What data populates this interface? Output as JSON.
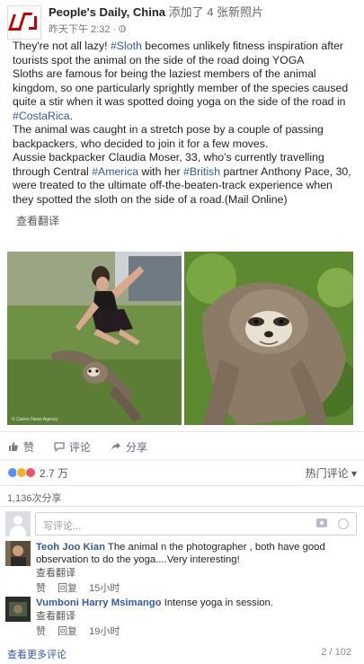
{
  "header": {
    "page_name": "People's Daily, China",
    "action_text": "添加了 4 张新照片",
    "time": "昨天下午 2:32 ·"
  },
  "post": {
    "paragraphs": [
      [
        {
          "t": "They're not all lazy! "
        },
        {
          "t": "#Sloth",
          "tag": true
        },
        {
          "t": " becomes unlikely fitness inspiration after tourists spot the animal on the side of the road doing YOGA"
        }
      ],
      [
        {
          "t": "Sloths are famous for being the laziest members of the animal kingdom, so one particularly sprightly member of the species caused quite a stir when it was spotted doing yoga on the side of the road in "
        },
        {
          "t": "#CostaRica",
          "tag": true
        },
        {
          "t": "."
        }
      ],
      [
        {
          "t": "The animal was caught in a stretch pose by a couple of passing backpackers, who decided to join it for a few moves."
        }
      ],
      [
        {
          "t": "Aussie backpacker Claudia Moser, 33, who's currently travelling through Central "
        },
        {
          "t": "#America",
          "tag": true
        },
        {
          "t": " with her "
        },
        {
          "t": "#British",
          "tag": true
        },
        {
          "t": " partner Anthony Pace, 30, were treated to the ultimate off-the-beaten-track experience when they spotted the sloth on the side of a road.(Mail Online)"
        }
      ]
    ],
    "see_translation": "查看翻译",
    "photo_caption": "© Caters News Agency"
  },
  "actions": {
    "like": "赞",
    "comment": "评论",
    "share": "分享"
  },
  "reactions": {
    "count": "2.7 万",
    "sort_label": "热门评论 ▾"
  },
  "shares": "1,136次分享",
  "comment_box": {
    "placeholder": "写评论..."
  },
  "comments": [
    {
      "author": "Teoh Joo Kian",
      "text": " The animal n the photographer , both have good observation to do the yoga....Very interesting!",
      "translate": "查看翻译",
      "like": "赞",
      "reply": "回复",
      "time": "15小时"
    },
    {
      "author": "Vumboni Harry Msimango",
      "text": " Intense yoga in session.",
      "translate": "查看翻译",
      "like": "赞",
      "reply": "回复",
      "time": "19小时"
    }
  ],
  "footer": {
    "more_comments": "查看更多评论",
    "pager": "2 / 102"
  },
  "colors": {
    "link": "#365899",
    "text": "#222222",
    "muted": "#606770",
    "brand_red": "#c40000"
  }
}
